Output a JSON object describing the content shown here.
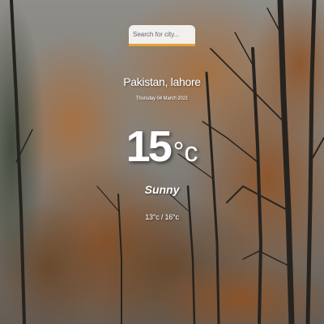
{
  "search": {
    "placeholder": "Search for city..."
  },
  "weather": {
    "location": "Pakistan, lahore",
    "date": "Thursday 04 March 2021",
    "temperature": "15",
    "unit": "°c",
    "condition": "Sunny",
    "range": "13°c / 16°c"
  },
  "colors": {
    "search_accent": "#e5a437",
    "text": "#ffffff"
  }
}
